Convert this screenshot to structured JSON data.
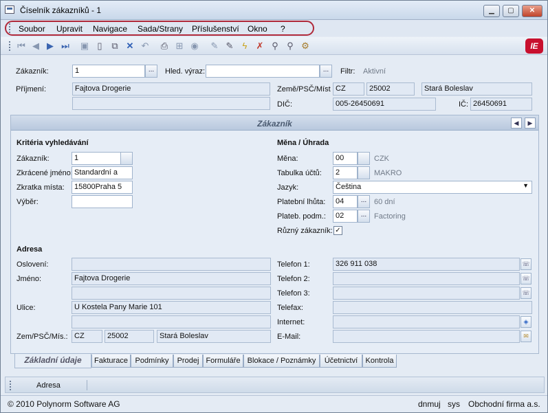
{
  "window": {
    "title": "Číselník zákazníků - 1"
  },
  "menu": [
    "Soubor",
    "Upravit",
    "Navigace",
    "Sada/Strany",
    "Příslušenství",
    "Okno",
    "?"
  ],
  "header": {
    "zakaznik_label": "Zákazník:",
    "zakaznik_value": "1",
    "hled_label": "Hled. výraz:",
    "hled_value": "",
    "filtr_label": "Filtr:",
    "filtr_value": "Aktivní",
    "prijmeni_label": "Příjmení:",
    "prijmeni_value": "Fajtova Drogerie",
    "prijmeni2_value": "",
    "zeme_label": "Země/PSČ/Míst",
    "zeme_value": "CZ",
    "psc_value": "25002",
    "misto_value": "Stará Boleslav",
    "dic_label": "DIČ:",
    "dic_value": "005-26450691",
    "ic_label": "IČ:",
    "ic_value": "26450691"
  },
  "panel": {
    "title": "Zákazník"
  },
  "kriteria": {
    "title": "Kritéria vyhledávání",
    "zakaznik_label": "Zákazník:",
    "zakaznik_value": "1",
    "zkraceny_label": "Zkrácené jméno:",
    "zkraceny_value": "Standardní a",
    "zkratka_label": "Zkratka místa:",
    "zkratka_value": "15800Praha 5",
    "vyber_label": "Výběr:",
    "vyber_value": ""
  },
  "mena": {
    "title": "Měna / Úhrada",
    "mena_label": "Měna:",
    "mena_value": "00",
    "mena_text": "CZK",
    "tabulka_label": "Tabulka účtů:",
    "tabulka_value": "2",
    "tabulka_text": "MAKRO",
    "jazyk_label": "Jazyk:",
    "jazyk_value": "Čeština",
    "lhuta_label": "Platební lhůta:",
    "lhuta_value": "04",
    "lhuta_text": "60 dní",
    "podm_label": "Plateb. podm.:",
    "podm_value": "02",
    "podm_text": "Factoring",
    "ruzny_label": "Různý zákazník:",
    "ruzny_mark": "✓"
  },
  "adresa": {
    "title": "Adresa",
    "osloveni_label": "Oslovení:",
    "osloveni_value": "",
    "jmeno_label": "Jméno:",
    "jmeno_value": "Fajtova Drogerie",
    "jmeno2_value": "",
    "ulice_label": "Ulice:",
    "ulice_value": "U Kostela Pany Marie 101",
    "ulice2_value": "",
    "zem_label": "Zem/PSČ/Mís.:",
    "zem_value": "CZ",
    "psc_value": "25002",
    "misto_value": "Stará Boleslav"
  },
  "kontakt": {
    "tel1_label": "Telefon 1:",
    "tel1_value": "326 911 038",
    "tel2_label": "Telefon 2:",
    "tel2_value": "",
    "tel3_label": "Telefon 3:",
    "tel3_value": "",
    "fax_label": "Telefax:",
    "fax_value": "",
    "web_label": "Internet:",
    "web_value": "",
    "mail_label": "E-Mail:",
    "mail_value": ""
  },
  "tabs": [
    "Základní údaje",
    "Fakturace",
    "Podmínky",
    "Prodej",
    "Formuláře",
    "Blokace / Poznámky",
    "Účetnictví",
    "Kontrola"
  ],
  "lower": {
    "adresa_label": "Adresa"
  },
  "status": {
    "copyright": "© 2010 Polynorm Software AG",
    "user": "dnmuj",
    "role": "sys",
    "company": "Obchodní firma a.s."
  },
  "logo_text": "IE",
  "colors": {
    "accent": "#b0293a",
    "panel": "#e6edf6"
  }
}
